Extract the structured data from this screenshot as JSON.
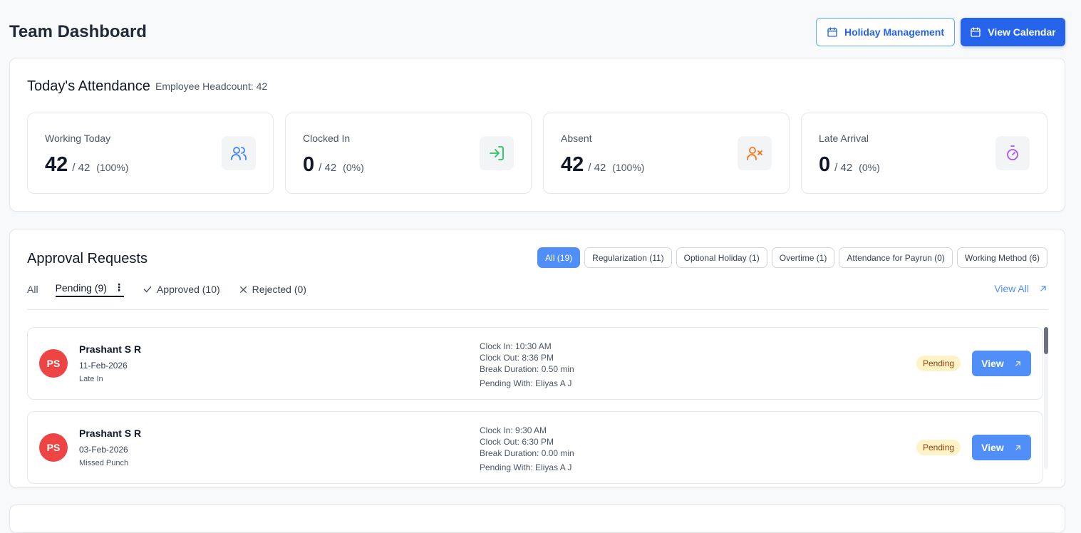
{
  "header": {
    "title": "Team Dashboard",
    "holiday_button": "Holiday Management",
    "calendar_button": "View Calendar"
  },
  "attendance": {
    "title": "Today's Attendance",
    "headcount": "Employee Headcount: 42",
    "stats": [
      {
        "label": "Working Today",
        "value": "42",
        "total": "/ 42",
        "percent": "(100%)",
        "icon": "users-icon",
        "icon_color": "#3b82f6"
      },
      {
        "label": "Clocked In",
        "value": "0",
        "total": "/ 42",
        "percent": "(0%)",
        "icon": "login-arrow-icon",
        "icon_color": "#22c55e"
      },
      {
        "label": "Absent",
        "value": "42",
        "total": "/ 42",
        "percent": "(100%)",
        "icon": "user-x-icon",
        "icon_color": "#f97316"
      },
      {
        "label": "Late Arrival",
        "value": "0",
        "total": "/ 42",
        "percent": "(0%)",
        "icon": "stopwatch-icon",
        "icon_color": "#a855f7"
      }
    ]
  },
  "approvals": {
    "title": "Approval Requests",
    "filters": [
      "All (19)",
      "Regularization (11)",
      "Optional Holiday (1)",
      "Overtime (1)",
      "Attendance for Payrun (0)",
      "Working Method (6)"
    ],
    "active_filter": "All (19)",
    "tabs": {
      "all": "All",
      "pending": "Pending (9)",
      "approved": "Approved (10)",
      "rejected": "Rejected (0)"
    },
    "view_all": "View All",
    "requests": [
      {
        "initials": "PS",
        "name": "Prashant S R",
        "date": "11-Feb-2026",
        "type": "Late In",
        "clock_in": "Clock In: 10:30 AM",
        "clock_out": "Clock Out: 8:36 PM",
        "break": "Break Duration: 0.50 min",
        "pending_with": "Pending With: Eliyas A J",
        "status": "Pending",
        "view": "View"
      },
      {
        "initials": "PS",
        "name": "Prashant S R",
        "date": "03-Feb-2026",
        "type": "Missed Punch",
        "clock_in": "Clock In: 9:30 AM",
        "clock_out": "Clock Out: 6:30 PM",
        "break": "Break Duration: 0.00 min",
        "pending_with": "Pending With: Eliyas A J",
        "status": "Pending",
        "view": "View"
      }
    ]
  },
  "colors": {
    "primary": "#2563eb",
    "accent": "#4f8ff7",
    "avatar": "#ef4444",
    "pending_badge_bg": "#fef3c7"
  }
}
